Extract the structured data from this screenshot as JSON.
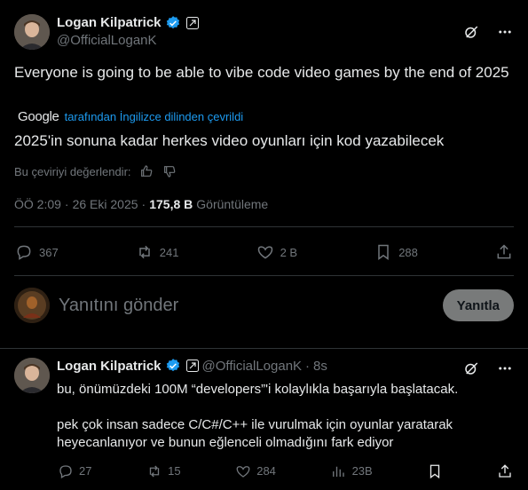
{
  "author": {
    "name": "Logan Kilpatrick",
    "handle": "@OfficialLoganK"
  },
  "tweet": {
    "text": "Everyone is going to be able to vibe code video games by the end of 2025",
    "translated_by_brand": "Google",
    "translated_by_text": "tarafından İngilizce dilinden çevrildi",
    "translation": "2025'in sonuna kadar herkes video oyunları için kod yazabilecek",
    "rate_label": "Bu çeviriyi değerlendir:",
    "time": "ÖÖ 2:09",
    "separator": "·",
    "date": "26 Eki 2025",
    "views_count": "175,8 B",
    "views_label": "Görüntüleme",
    "stats": {
      "replies": "367",
      "reposts": "241",
      "likes": "2 B",
      "bookmarks": "288"
    }
  },
  "compose": {
    "placeholder": "Yanıtını gönder",
    "button_label": "Yanıtla"
  },
  "reply": {
    "name": "Logan Kilpatrick",
    "handle": "@OfficialLoganK",
    "dot": "·",
    "time": "8s",
    "paragraph1": "bu, önümüzdeki 100M “developers”'i kolaylıkla başarıyla başlatacak.",
    "paragraph2": "pek çok insan sadece C/C#/C++ ile vurulmak için oyunlar yaratarak heyecanlanıyor ve bunun eğlenceli olmadığını fark ediyor",
    "stats": {
      "replies": "27",
      "reposts": "15",
      "likes": "284",
      "views": "23B"
    }
  },
  "colors": {
    "background": "#000000",
    "text": "#e7e9ea",
    "muted": "#71767b",
    "link": "#1d9bf0",
    "verified": "#1d9bf0",
    "divider": "#2f3336"
  }
}
